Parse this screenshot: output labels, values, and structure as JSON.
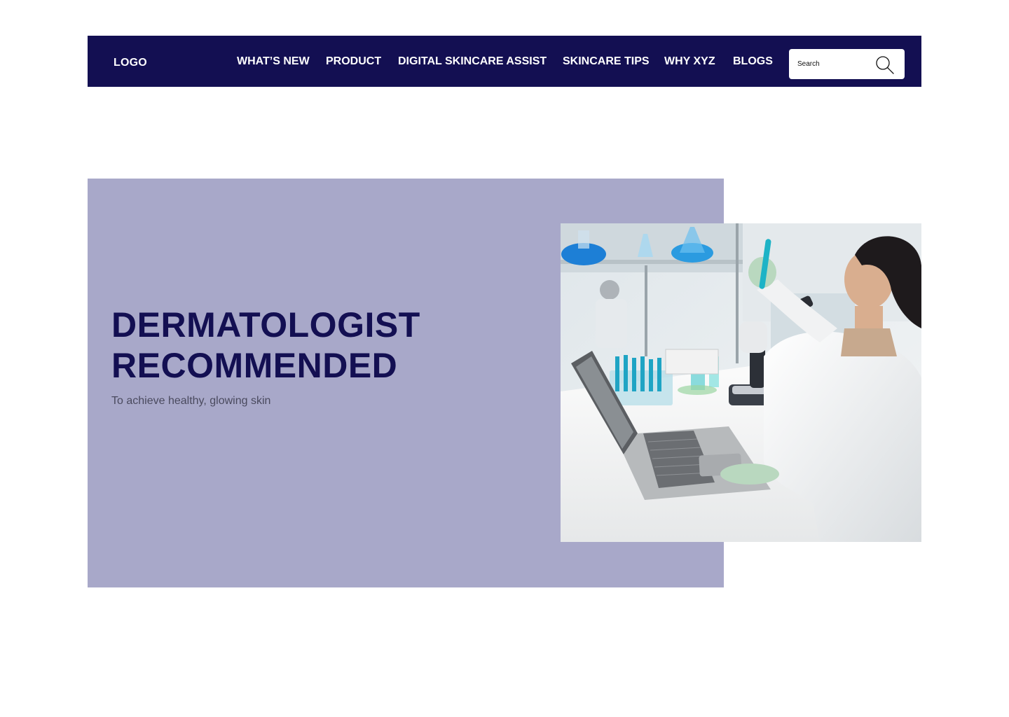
{
  "header": {
    "logo": "LOGO",
    "nav": [
      {
        "label": "WHAT’S NEW"
      },
      {
        "label": "PRODUCT"
      },
      {
        "label": "DIGITAL SKINCARE ASSIST"
      },
      {
        "label": "SKINCARE TIPS"
      },
      {
        "label": "WHY XYZ"
      },
      {
        "label": "BLOGS"
      }
    ],
    "search": {
      "placeholder": "Search",
      "icon": "search-icon"
    }
  },
  "hero": {
    "title_line1": "DERMATOLOGIST",
    "title_line2": "RECOMMENDED",
    "subtitle": "To achieve healthy, glowing skin",
    "photo_alt": "Woman scientist in lab coat holding a test tube next to a laptop in a laboratory"
  },
  "colors": {
    "navbar_bg": "#130f52",
    "hero_bg": "#a8a8c9",
    "title_color": "#130f52"
  }
}
